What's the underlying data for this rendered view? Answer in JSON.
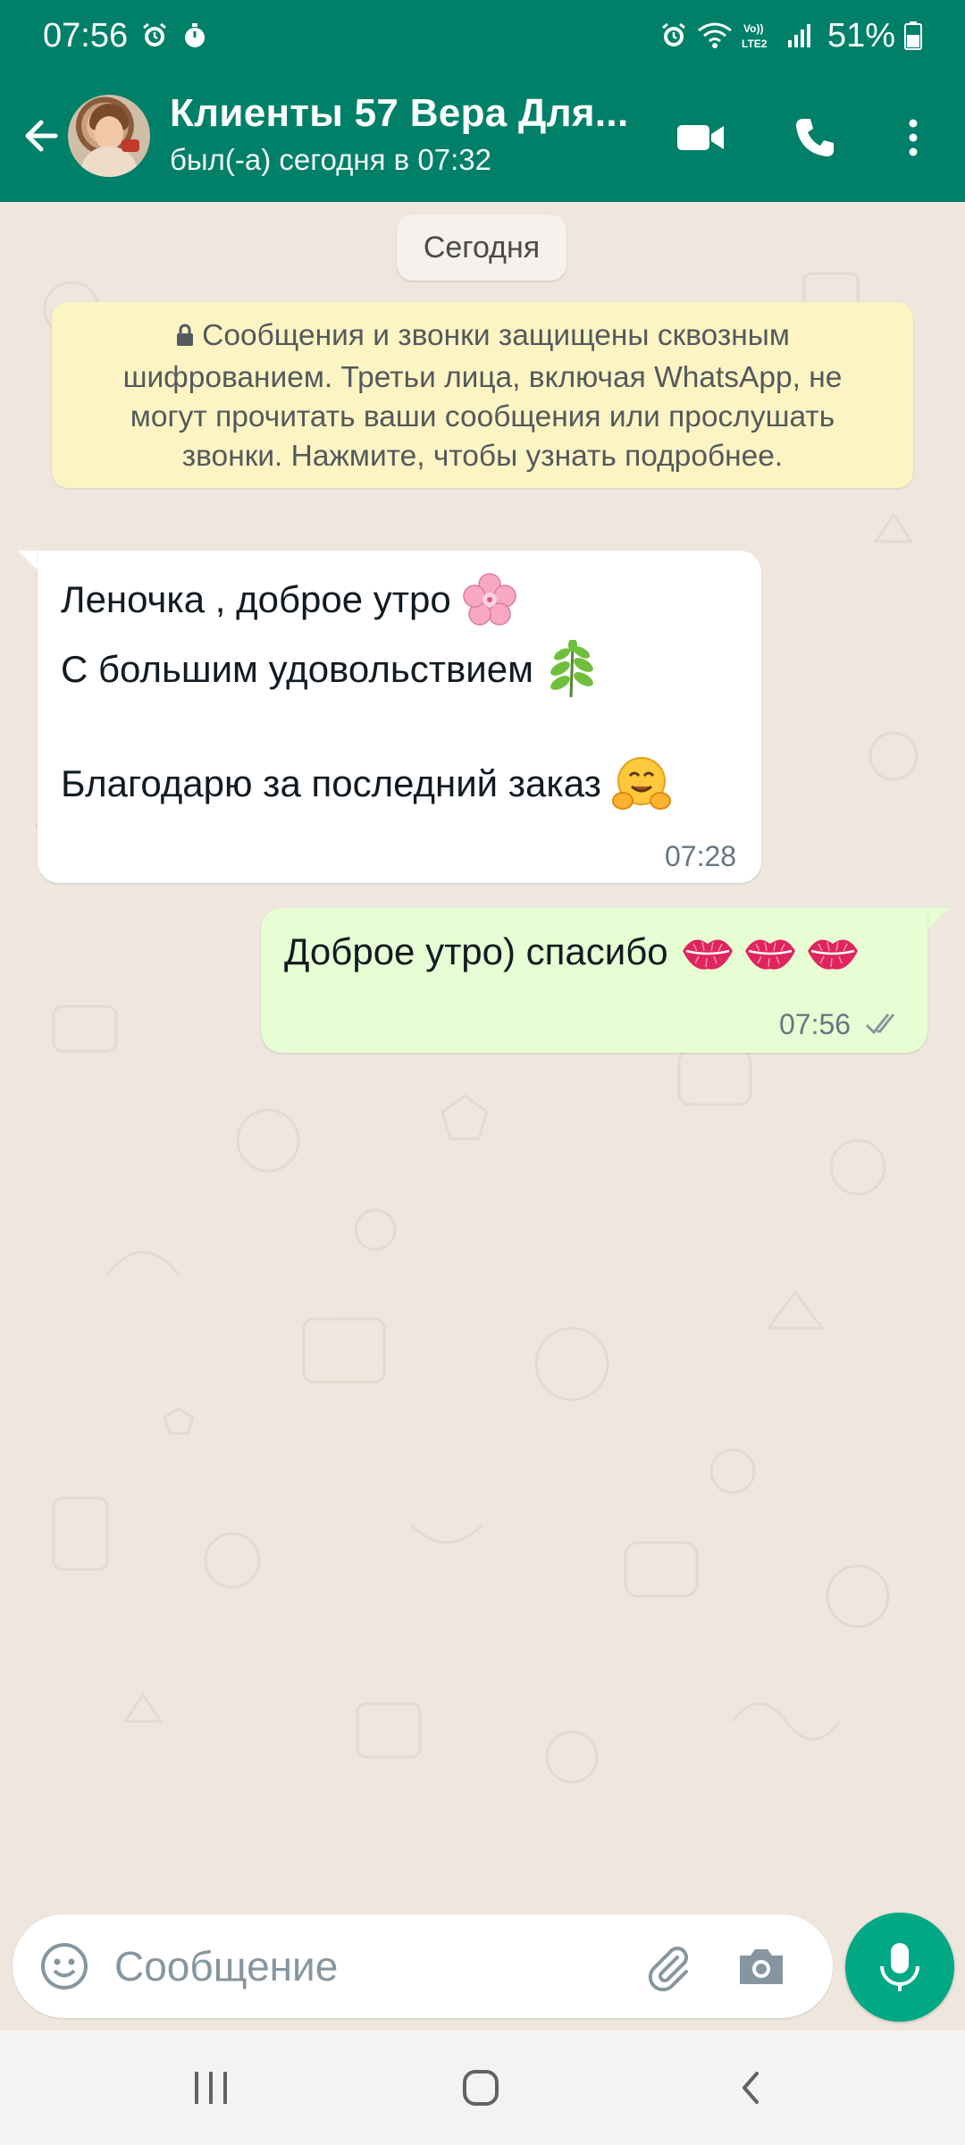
{
  "status_bar": {
    "time": "07:56",
    "battery_percent": "51%",
    "network_label": "LTE2"
  },
  "header": {
    "contact_name": "Клиенты 57 Вера Для...",
    "contact_status": "был(-а) сегодня в 07:32",
    "color": "#008069"
  },
  "chat": {
    "date_label": "Сегодня",
    "encryption_notice": "Сообщения и звонки защищены сквозным шифрованием. Третьи лица, включая WhatsApp, не могут прочитать ваши сообщения или прослушать звонки. Нажмите, чтобы узнать подробнее.",
    "incoming": {
      "line1": "Леночка , доброе утро",
      "line1_emoji": "cherry-blossom",
      "line2": "С большим удовольствием",
      "line2_emoji": "herb",
      "line3": "Благодарю за последний заказ",
      "line3_emoji": "hugging-face",
      "time": "07:28"
    },
    "outgoing": {
      "text": "Доброе утро) спасибо",
      "emojis": [
        "kiss-mark",
        "kiss-mark",
        "kiss-mark"
      ],
      "time": "07:56",
      "status": "read"
    }
  },
  "composer": {
    "placeholder": "Сообщение"
  },
  "colors": {
    "accent": "#00a884",
    "outgoing_bubble": "#e7fdd3",
    "notice_bg": "#fdf4c4"
  }
}
